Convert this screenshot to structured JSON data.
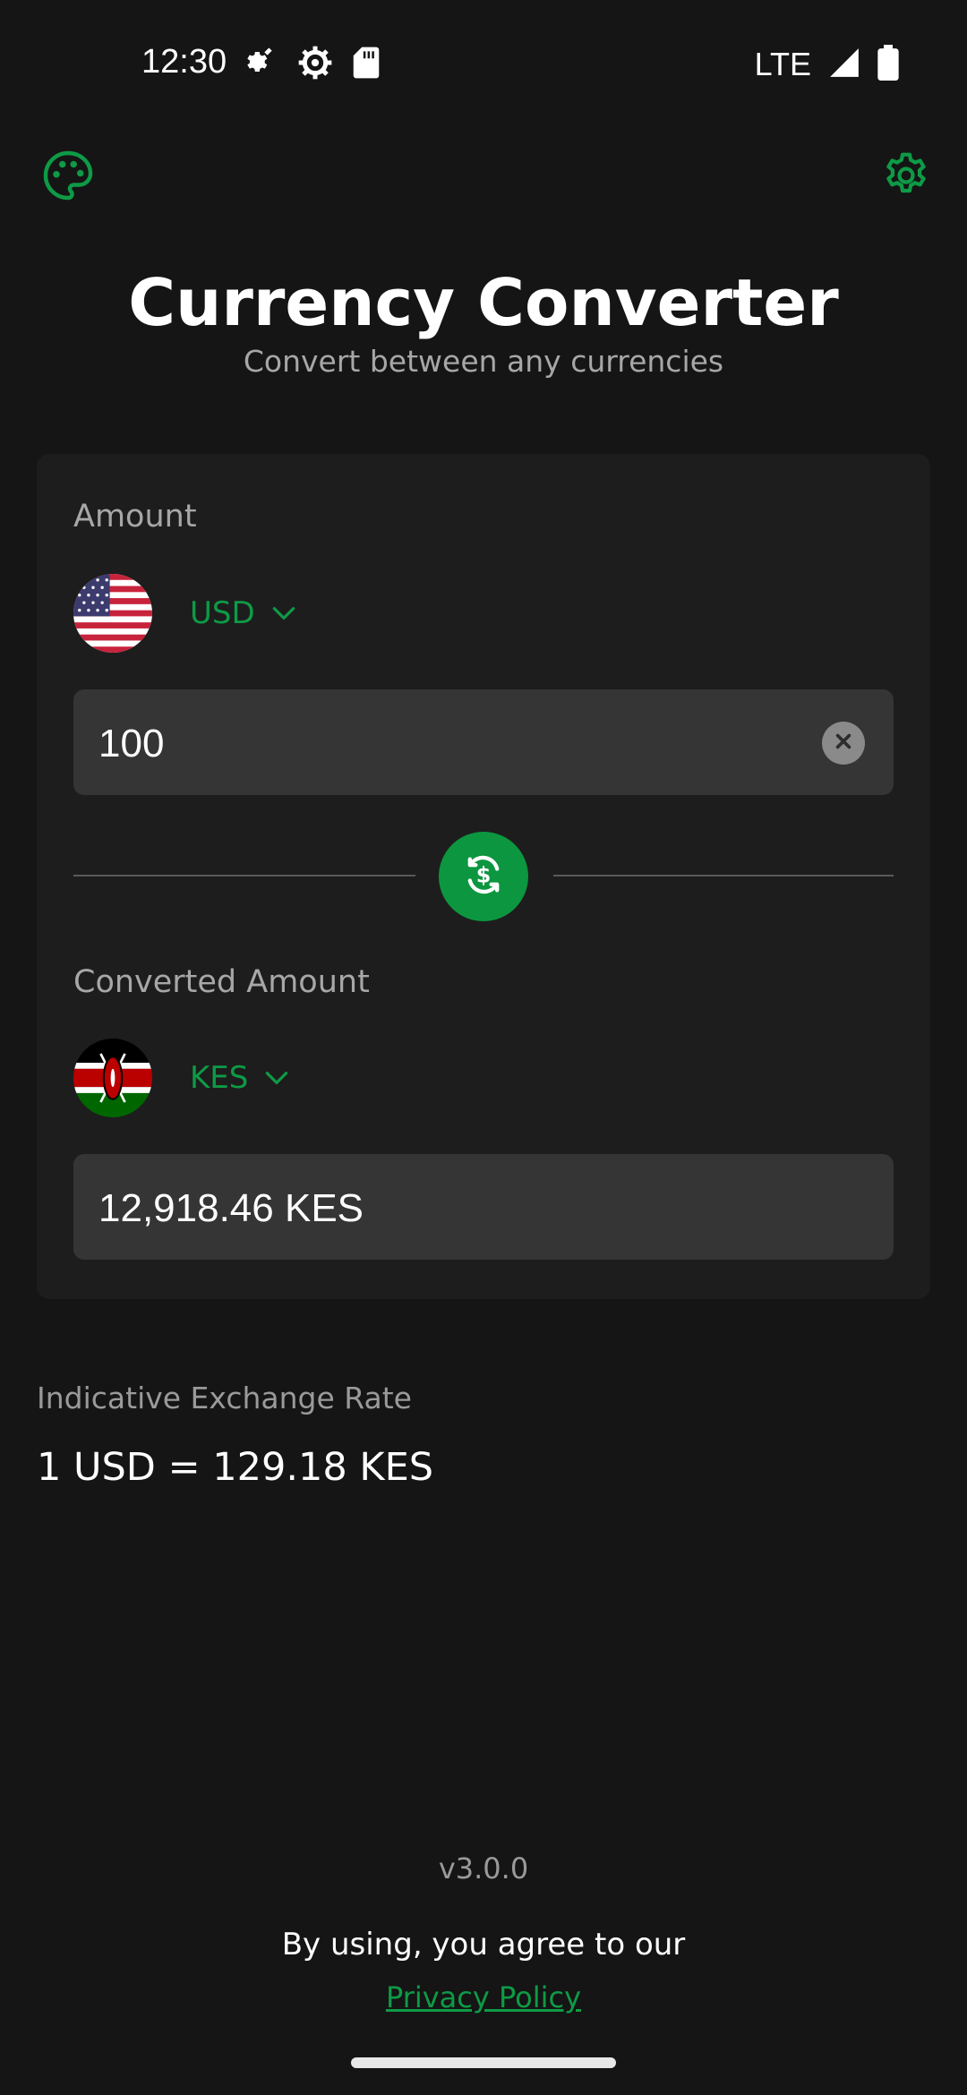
{
  "status_bar": {
    "time": "12:30",
    "network": "LTE",
    "icons_left": [
      "gear-icon",
      "settings-icon",
      "sd-card-icon"
    ],
    "icons_right": [
      "signal-icon",
      "battery-icon"
    ]
  },
  "header": {
    "title": "Currency Converter",
    "subtitle": "Convert between any currencies"
  },
  "converter": {
    "amount_label": "Amount",
    "from_currency": "USD",
    "from_flag": "us-flag",
    "amount_value": "100",
    "swap_icon": "currency-swap-icon",
    "converted_label": "Converted Amount",
    "to_currency": "KES",
    "to_flag": "kenya-flag",
    "converted_value": "12,918.46 KES"
  },
  "rate": {
    "label": "Indicative Exchange Rate",
    "value": "1 USD = 129.18 KES"
  },
  "footer": {
    "version": "v3.0.0",
    "agree_text": "By using, you agree to our",
    "privacy_link": "Privacy Policy"
  },
  "colors": {
    "background": "#151515",
    "card": "#1d1d1d",
    "input": "#353535",
    "accent": "#0c963f",
    "muted_text": "#a7a7a7"
  }
}
